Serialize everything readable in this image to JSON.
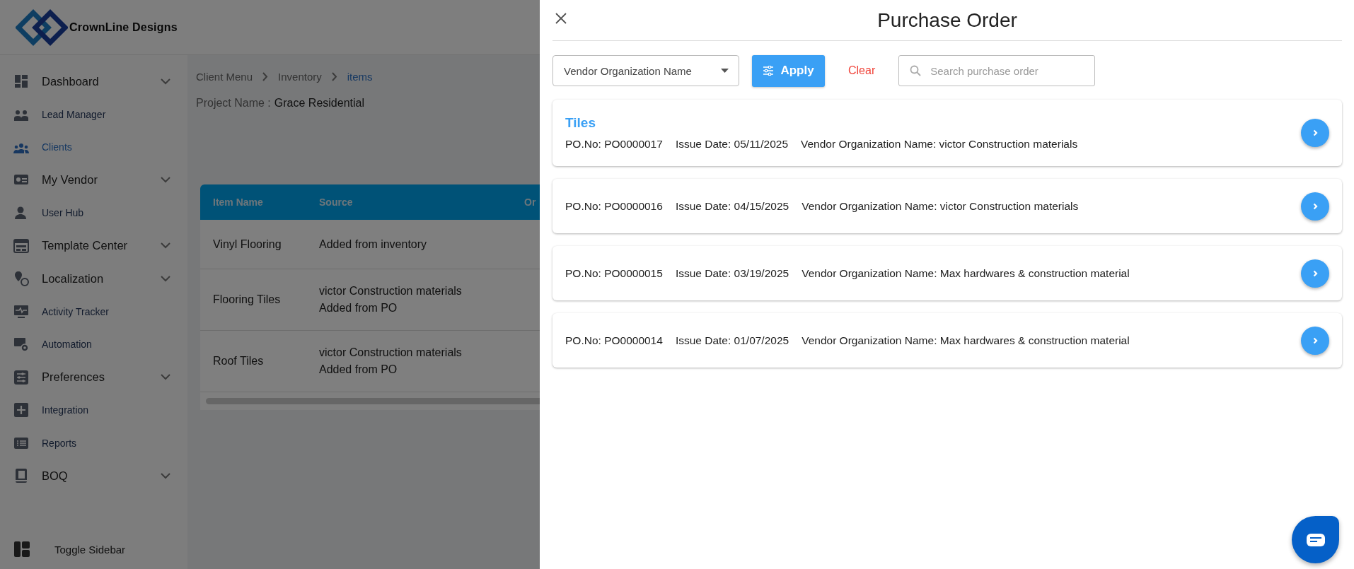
{
  "brand": {
    "name": "CrownLine Designs"
  },
  "sidebar": {
    "items": [
      {
        "label": "Dashboard",
        "expandable": true,
        "selected": false
      },
      {
        "label": "Lead Manager",
        "expandable": false,
        "selected": false
      },
      {
        "label": "Clients",
        "expandable": false,
        "selected": true
      },
      {
        "label": "My Vendor",
        "expandable": true,
        "selected": false
      },
      {
        "label": "User Hub",
        "expandable": false,
        "selected": false
      },
      {
        "label": "Template Center",
        "expandable": true,
        "selected": false
      },
      {
        "label": "Localization",
        "expandable": true,
        "selected": false
      },
      {
        "label": "Activity Tracker",
        "expandable": false,
        "selected": false
      },
      {
        "label": "Automation",
        "expandable": false,
        "selected": false
      },
      {
        "label": "Preferences",
        "expandable": true,
        "selected": false
      },
      {
        "label": "Integration",
        "expandable": false,
        "selected": false
      },
      {
        "label": "Reports",
        "expandable": false,
        "selected": false
      },
      {
        "label": "BOQ",
        "expandable": true,
        "selected": false
      }
    ],
    "toggle": "Toggle Sidebar"
  },
  "breadcrumb": [
    {
      "label": "Client Menu",
      "current": false
    },
    {
      "label": "Inventory",
      "current": false
    },
    {
      "label": "items",
      "current": true
    }
  ],
  "project": {
    "label": "Project Name :",
    "value": "Grace Residential"
  },
  "table": {
    "columns": [
      "Item Name",
      "Source",
      "Or"
    ],
    "rows": [
      {
        "item_name": "Vinyl Flooring",
        "source": [
          "Added from inventory"
        ]
      },
      {
        "item_name": "Flooring Tiles",
        "source": [
          "victor Construction materials",
          "Added from PO"
        ]
      },
      {
        "item_name": "Roof Tiles",
        "source": [
          "victor Construction materials",
          "Added from PO"
        ]
      }
    ]
  },
  "panel": {
    "title": "Purchase Order",
    "filter": {
      "vendor_select": "Vendor Organization Name",
      "apply": "Apply",
      "clear": "Clear",
      "search_placeholder": "Search purchase order"
    },
    "orders": [
      {
        "title": "Tiles",
        "po_no": "PO.No: PO0000017",
        "issue_date": "Issue Date: 05/11/2025",
        "vendor": "Vendor Organization Name: victor Construction materials"
      },
      {
        "po_no": "PO.No: PO0000016",
        "issue_date": "Issue Date: 04/15/2025",
        "vendor": "Vendor Organization Name: victor Construction materials"
      },
      {
        "po_no": "PO.No: PO0000015",
        "issue_date": "Issue Date: 03/19/2025",
        "vendor": "Vendor Organization Name: Max hardwares & construction material"
      },
      {
        "po_no": "PO.No: PO0000014",
        "issue_date": "Issue Date: 01/07/2025",
        "vendor": "Vendor Organization Name: Max hardwares & construction material"
      }
    ]
  }
}
